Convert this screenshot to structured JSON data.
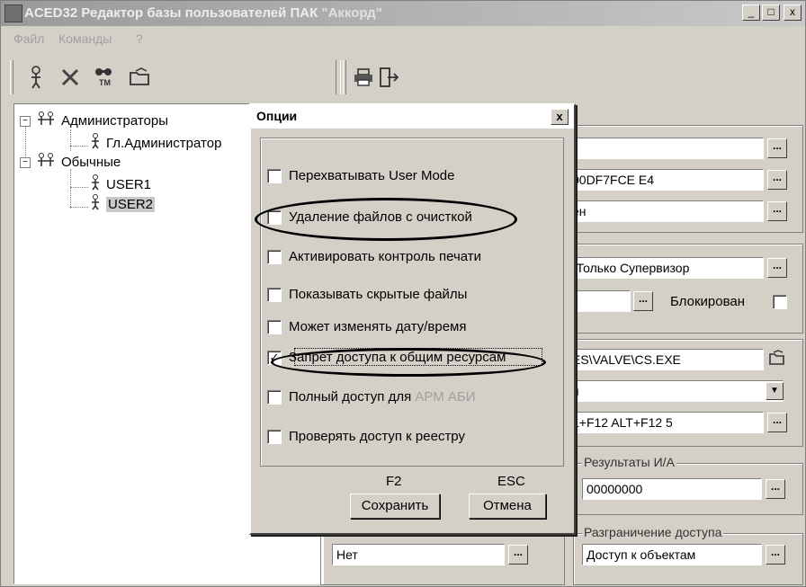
{
  "window": {
    "title_prefix": "ACED32 Редактор базы пользователей ПАК ",
    "title_quoted": "\"Аккорд\"",
    "min_label": "_",
    "max_label": "□",
    "close_label": "x"
  },
  "menu": {
    "items": [
      {
        "label": "Файл"
      },
      {
        "label": "Команды"
      },
      {
        "label": "?"
      }
    ]
  },
  "toolbar": {
    "icons": [
      "add-user-icon",
      "delete-icon",
      "find-icon",
      "open-folder-icon",
      "print-icon",
      "exit-icon"
    ],
    "find_glyph": "TM"
  },
  "tree": {
    "items": [
      {
        "label": "Администраторы",
        "expander": "−"
      },
      {
        "label": "Гл.Администратор"
      },
      {
        "label": "Обычные",
        "expander": "−"
      },
      {
        "label": "USER1"
      },
      {
        "label": "USER2"
      }
    ]
  },
  "right_panel": {
    "fields": [
      {
        "value": ""
      },
      {
        "value": "00DF7FCE E4"
      },
      {
        "value": "ен"
      },
      {
        "value": "-Только Супервизор"
      },
      {
        "value": ""
      },
      {
        "value": "ES\\VALVE\\CS.EXE"
      },
      {
        "value": "я"
      },
      {
        "value": "L+F12 ALT+F12 5"
      }
    ],
    "blocked_label": "Блокирован",
    "results_label": "Результаты И/А",
    "results_value": "00000000",
    "access_label": "Разграничение доступа",
    "access_value": "Доступ к объектам",
    "bottom_left_value": "Нет",
    "ellipsis": "..."
  },
  "dialog": {
    "title": "Опции",
    "close_label": "x",
    "options": [
      {
        "label": "Перехватывать User Mode",
        "checked": false
      },
      {
        "label": "Удаление файлов с очисткой",
        "checked": false
      },
      {
        "label": "Активировать контроль печати",
        "checked": false
      },
      {
        "label": "Показывать скрытые файлы",
        "checked": false
      },
      {
        "label": "Может изменять дату/время",
        "checked": false
      },
      {
        "label": "Запрет доступа к общим ресурсам",
        "checked": true
      },
      {
        "label_prefix": "Полный доступ для ",
        "label_dim": "АРМ АБИ",
        "checked": false
      },
      {
        "label": "Проверять доступ к реестру",
        "checked": false
      }
    ],
    "check_mark": "✓",
    "save_key": "F2",
    "cancel_key": "ESC",
    "save_label": "Сохранить",
    "cancel_label": "Отмена"
  }
}
